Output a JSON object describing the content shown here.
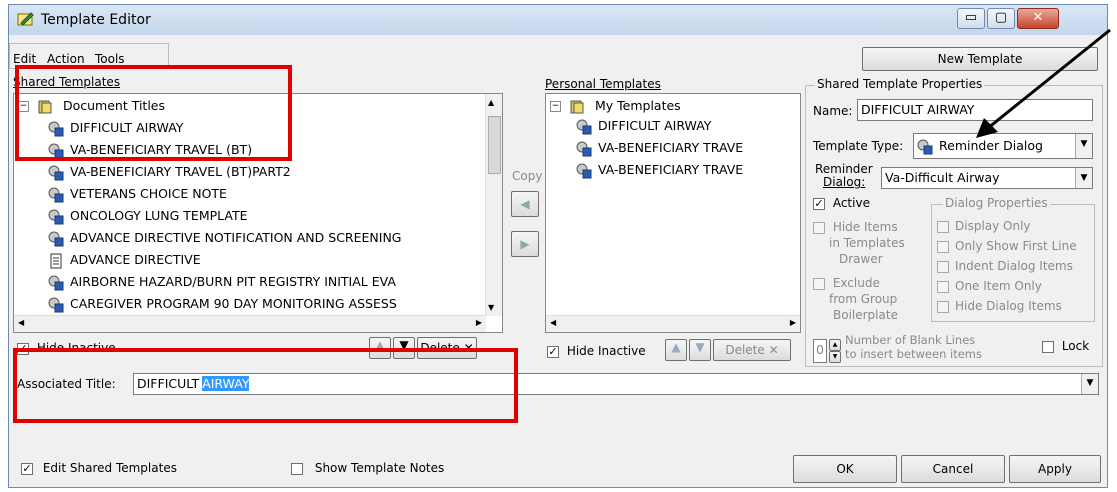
{
  "window": {
    "title": "Template Editor",
    "controls": {
      "minimize": "▭",
      "maximize": "▢",
      "close": "✕"
    }
  },
  "menu": {
    "edit": "Edit",
    "action": "Action",
    "tools": "Tools"
  },
  "new_template_button": "New Template",
  "shared": {
    "header": "Shared Templates",
    "root": "Document Titles",
    "items": [
      "DIFFICULT AIRWAY",
      "VA-BENEFICIARY TRAVEL (BT)",
      "VA-BENEFICIARY TRAVEL (BT)PART2",
      "VETERANS CHOICE NOTE",
      "ONCOLOGY LUNG TEMPLATE",
      "ADVANCE DIRECTIVE NOTIFICATION AND SCREENING",
      "ADVANCE DIRECTIVE",
      "AIRBORNE HAZARD/BURN PIT REGISTRY INITIAL EVA",
      "CAREGIVER PROGRAM 90 DAY MONITORING ASSESS"
    ],
    "hide_inactive": "Hide Inactive",
    "delete": "Delete"
  },
  "copy_label": "Copy",
  "personal": {
    "header": "Personal Templates",
    "root": "My Templates",
    "items": [
      "DIFFICULT AIRWAY",
      "VA-BENEFICIARY TRAVE",
      "VA-BENEFICIARY TRAVE"
    ],
    "hide_inactive": "Hide Inactive",
    "delete": "Delete"
  },
  "properties": {
    "header": "Shared Template Properties",
    "name_label": "Name:",
    "name_value": "DIFFICULT AIRWAY",
    "type_label": "Template Type:",
    "type_value": "Reminder Dialog",
    "reminder_label_1": "Reminder",
    "reminder_label_2": "Dialog:",
    "reminder_value": "Va-Difficult Airway",
    "active": "Active",
    "hide_items_1": "Hide Items",
    "hide_items_2": "in Templates",
    "hide_items_3": "Drawer",
    "exclude_1": "Exclude",
    "exclude_2": "from Group",
    "exclude_3": "Boilerplate",
    "dialog_props_header": "Dialog Properties",
    "dialog_props": [
      "Display Only",
      "Only Show First Line",
      "Indent Dialog Items",
      "One Item Only",
      "Hide Dialog Items"
    ],
    "blank_lines_value": "0",
    "blank_lines_label_1": "Number of Blank Lines",
    "blank_lines_label_2": "to insert between items",
    "lock": "Lock"
  },
  "associated": {
    "label": "Associated Title:",
    "value_plain": "DIFFICULT",
    "value_selected": "AIRWAY"
  },
  "bottom": {
    "edit_shared": "Edit Shared Templates",
    "show_notes": "Show Template Notes",
    "ok": "OK",
    "cancel": "Cancel",
    "apply": "Apply"
  },
  "colors": {
    "highlight_box": "#e00000",
    "selection": "#3399ff"
  }
}
